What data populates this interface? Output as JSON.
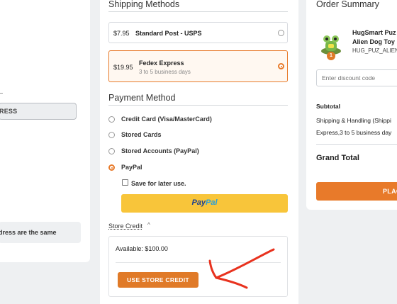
{
  "left": {
    "shipping_select_value": "RESS",
    "same_address_note": "dress are the same"
  },
  "shipping": {
    "title": "Shipping Methods",
    "options": [
      {
        "price": "$7.95",
        "name": "Standard Post - USPS",
        "subtitle": "",
        "selected": false
      },
      {
        "price": "$19.95",
        "name": "Fedex Express",
        "subtitle": "3 to 5 business days",
        "selected": true
      }
    ]
  },
  "payment": {
    "title": "Payment Method",
    "options": [
      {
        "label": "Credit Card (Visa/MasterCard)",
        "selected": false
      },
      {
        "label": "Stored Cards",
        "selected": false
      },
      {
        "label": "Stored Accounts (PayPal)",
        "selected": false
      },
      {
        "label": "PayPal",
        "selected": true
      }
    ],
    "save_label": "Save for later use.",
    "paypal_button": {
      "part1": "Pay",
      "part2": "Pal"
    }
  },
  "store_credit": {
    "link_label": "Store Credit",
    "caret": "^",
    "available": "Available: $100.00",
    "use_button": "USE STORE CREDIT"
  },
  "summary": {
    "title": "Order Summary",
    "product_name_line1": "HugSmart Puz",
    "product_name_line2": "Alien Dog Toy",
    "product_sku": "HUG_PUZ_ALIEN",
    "quantity": "1",
    "discount_placeholder": "Enter discount code",
    "subtotal_label": "Subtotal",
    "shipping_label": "Shipping & Handling (Shippi",
    "shipping_detail": "Express,3 to 5 business day",
    "grand_total_label": "Grand Total",
    "place_button": "PLAC"
  },
  "colors": {
    "accent": "#e87a2a",
    "annotation_arrow": "#e8321e",
    "paypal_yellow": "#f8c53a"
  }
}
